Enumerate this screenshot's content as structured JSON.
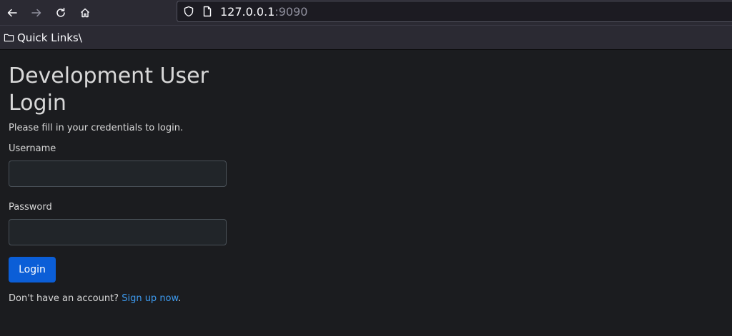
{
  "browser": {
    "url_host": "127.0.0.1",
    "url_port": ":9090",
    "bookmark_folder": "Quick Links\\"
  },
  "page": {
    "title": "Development User Login",
    "lead": "Please fill in your credentials to login.",
    "username_label": "Username",
    "username_value": "",
    "password_label": "Password",
    "password_value": "",
    "login_button": "Login",
    "signup_prompt": "Don't have an account? ",
    "signup_link": "Sign up now",
    "signup_suffix": "."
  },
  "colors": {
    "accent": "#0b5ed7",
    "link": "#3d9bf0",
    "background": "#1b1c1f"
  },
  "icons": [
    "back-arrow-icon",
    "forward-arrow-icon",
    "reload-icon",
    "home-icon",
    "shield-icon",
    "page-icon",
    "folder-icon"
  ]
}
